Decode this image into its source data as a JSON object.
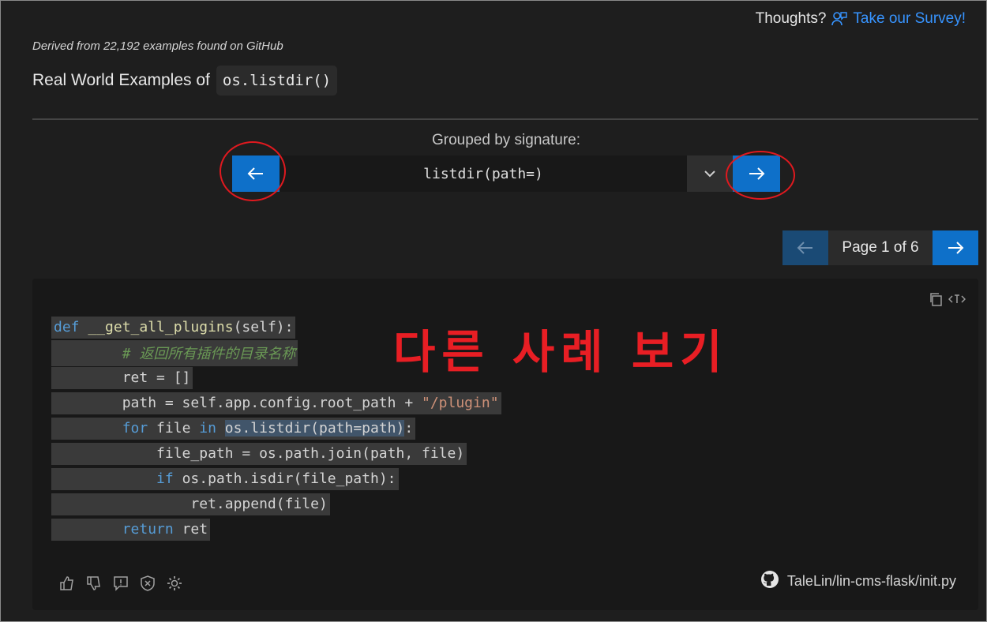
{
  "header": {
    "thoughts_label": "Thoughts?",
    "survey_link": "Take our Survey!"
  },
  "examples": {
    "derived_text": "Derived from 22,192 examples found on GitHub",
    "heading_prefix": "Real World Examples of",
    "function_name": "os.listdir()"
  },
  "signature": {
    "grouped_label": "Grouped by signature:",
    "selected": "listdir(path=)"
  },
  "pager": {
    "label": "Page 1 of 6"
  },
  "code": {
    "lines": [
      {
        "indent": "",
        "tokens": [
          {
            "t": "def ",
            "c": "kw"
          },
          {
            "t": "__get_all_plugins",
            "c": "fn"
          },
          {
            "t": "(self):",
            "c": "txt"
          }
        ]
      },
      {
        "indent": "        ",
        "tokens": [
          {
            "t": "# 返回所有插件的目录名称",
            "c": "cmt"
          }
        ]
      },
      {
        "indent": "        ",
        "tokens": [
          {
            "t": "ret = []",
            "c": "txt"
          }
        ]
      },
      {
        "indent": "        ",
        "tokens": [
          {
            "t": "path = self.app.config.root_path + ",
            "c": "txt"
          },
          {
            "t": "\"/plugin\"",
            "c": "str"
          }
        ]
      },
      {
        "indent": "        ",
        "tokens": [
          {
            "t": "for",
            "c": "kw"
          },
          {
            "t": " file ",
            "c": "txt"
          },
          {
            "t": "in",
            "c": "kw"
          },
          {
            "t": " ",
            "c": "txt"
          },
          {
            "t": "os.listdir(path=path)",
            "c": "txt sel"
          },
          {
            "t": ":",
            "c": "txt"
          }
        ]
      },
      {
        "indent": "            ",
        "tokens": [
          {
            "t": "file_path = os.path.join(path, file)",
            "c": "txt"
          }
        ]
      },
      {
        "indent": "            ",
        "tokens": [
          {
            "t": "if",
            "c": "kw"
          },
          {
            "t": " os.path.isdir(file_path):",
            "c": "txt"
          }
        ]
      },
      {
        "indent": "                ",
        "tokens": [
          {
            "t": "ret.append(file)",
            "c": "txt"
          }
        ]
      },
      {
        "indent": "        ",
        "tokens": [
          {
            "t": "return",
            "c": "kw"
          },
          {
            "t": " ret",
            "c": "txt"
          }
        ]
      }
    ]
  },
  "annotation": {
    "text": "다른 사례 보기",
    "color": "#e81e24"
  },
  "source": {
    "path": "TaleLin/lin-cms-flask/init.py"
  },
  "feedback": {
    "icons": [
      "thumbs-up-icon",
      "thumbs-down-icon",
      "report-icon",
      "shield-x-icon",
      "settings-gear-icon"
    ]
  },
  "colors": {
    "accent": "#0e70c9",
    "link": "#3794ff",
    "background": "#1e1e1e"
  }
}
